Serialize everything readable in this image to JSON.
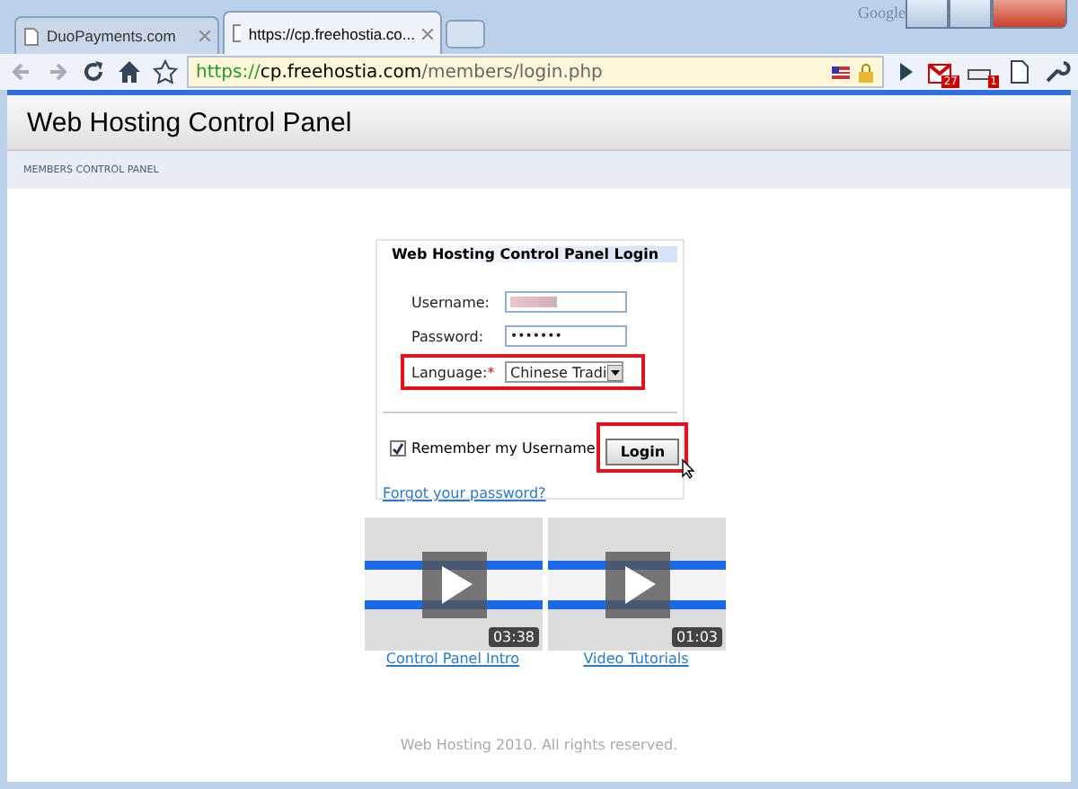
{
  "browser": {
    "brand": "Google",
    "tabs": [
      {
        "title": "DuoPayments.com",
        "selected": false
      },
      {
        "title": "https://cp.freehostia.co...",
        "selected": true
      }
    ],
    "address": {
      "scheme": "https://",
      "host": "cp.freehostia.com",
      "path": "/members/login.php"
    },
    "badges": [
      "27",
      "1"
    ]
  },
  "header": {
    "title": "Web Hosting Control Panel"
  },
  "nav": {
    "label": "MEMBERS CONTROL PANEL"
  },
  "login": {
    "title": "Web Hosting Control Panel Login",
    "fields": [
      {
        "label": "Username:",
        "kind": "blurred",
        "highlighted": false
      },
      {
        "label": "Password:",
        "kind": "password",
        "value": "•••••••",
        "highlighted": false
      },
      {
        "label": "Language:",
        "kind": "select",
        "value": "Chinese Tradi",
        "required_mark": "*",
        "highlighted": true
      }
    ],
    "remember": {
      "label": "Remember my Username",
      "checked": true
    },
    "button": {
      "label": "Login",
      "highlighted": true
    },
    "forgot": "Forgot your password?"
  },
  "videos": [
    {
      "duration": "03:38",
      "caption": "Control Panel Intro"
    },
    {
      "duration": "01:03",
      "caption": "Video Tutorials"
    }
  ],
  "footer": "Web Hosting 2010. All rights reserved."
}
